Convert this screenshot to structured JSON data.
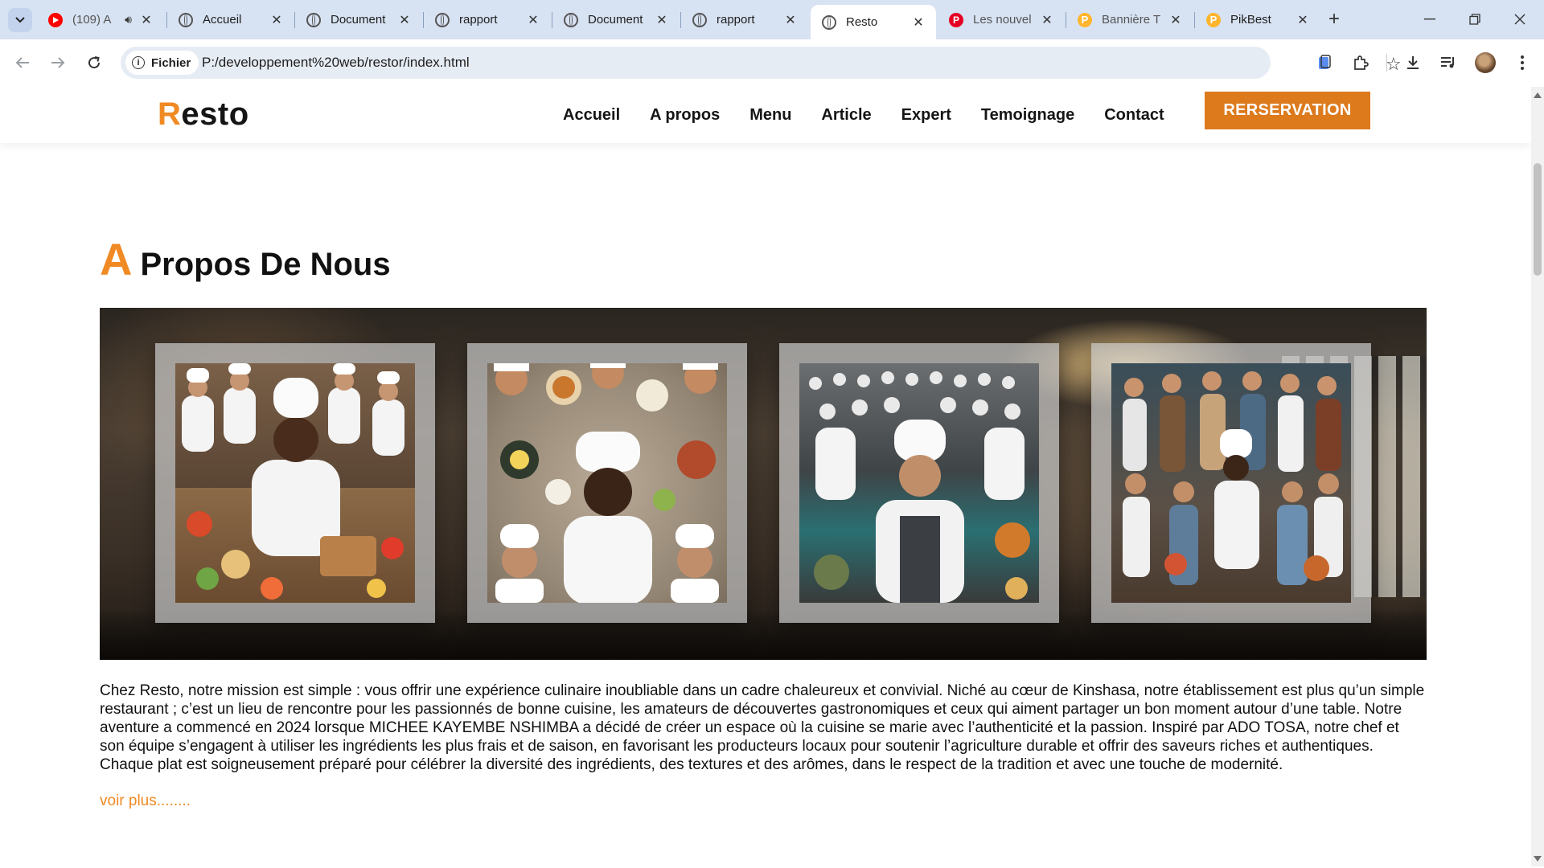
{
  "browser": {
    "tabs": [
      {
        "title": "(109) A",
        "favicon": "youtube-icon",
        "has_audio": true
      },
      {
        "title": "Accueil",
        "favicon": "globe-icon"
      },
      {
        "title": "Document",
        "favicon": "globe-icon"
      },
      {
        "title": "rapport",
        "favicon": "globe-icon"
      },
      {
        "title": "Document",
        "favicon": "globe-icon"
      },
      {
        "title": "rapport",
        "favicon": "globe-icon"
      },
      {
        "title": "Resto",
        "favicon": "globe-icon",
        "active": true
      },
      {
        "title": "Les nouvel",
        "favicon": "pinterest-icon"
      },
      {
        "title": "Bannière T",
        "favicon": "pikbest-icon"
      },
      {
        "title": "PikBest",
        "favicon": "pikbest-icon"
      }
    ],
    "address": {
      "chip_label": "Fichier",
      "url": "P:/developpement%20web/restor/index.html"
    }
  },
  "site": {
    "logo": {
      "accent_letter": "R",
      "rest": "esto"
    },
    "nav": [
      "Accueil",
      "A propos",
      "Menu",
      "Article",
      "Expert",
      "Temoignage",
      "Contact"
    ],
    "cta": "RERSERVATION",
    "accent_color": "#f08a24",
    "cta_color": "#dc7a1c"
  },
  "about": {
    "title_accent": "A",
    "title_rest": "Propos De Nous",
    "photos": [
      "chefs-team-photo",
      "chefs-overhead-photo",
      "kitchen-brigade-photo",
      "chefs-group-photo"
    ],
    "text": "Chez Resto, notre mission est simple : vous offrir une expérience culinaire inoubliable dans un cadre chaleureux et convivial. Niché au cœur de Kinshasa, notre établissement est plus qu’un simple restaurant ; c’est un lieu de rencontre pour les passionnés de bonne cuisine, les amateurs de découvertes gastronomiques et ceux qui aiment partager un bon moment autour d’une table. Notre aventure a commencé en 2024 lorsque MICHEE KAYEMBE NSHIMBA a décidé de créer un espace où la cuisine se marie avec l’authenticité et la passion. Inspiré par ADO TOSA, notre chef et son équipe s’engagent à utiliser les ingrédients les plus frais et de saison, en favorisant les producteurs locaux pour soutenir l’agriculture durable et offrir des saveurs riches et authentiques. Chaque plat est soigneusement préparé pour célébrer la diversité des ingrédients, des textures et des arômes, dans le respect de la tradition et avec une touche de modernité.",
    "more": "voir plus........"
  }
}
